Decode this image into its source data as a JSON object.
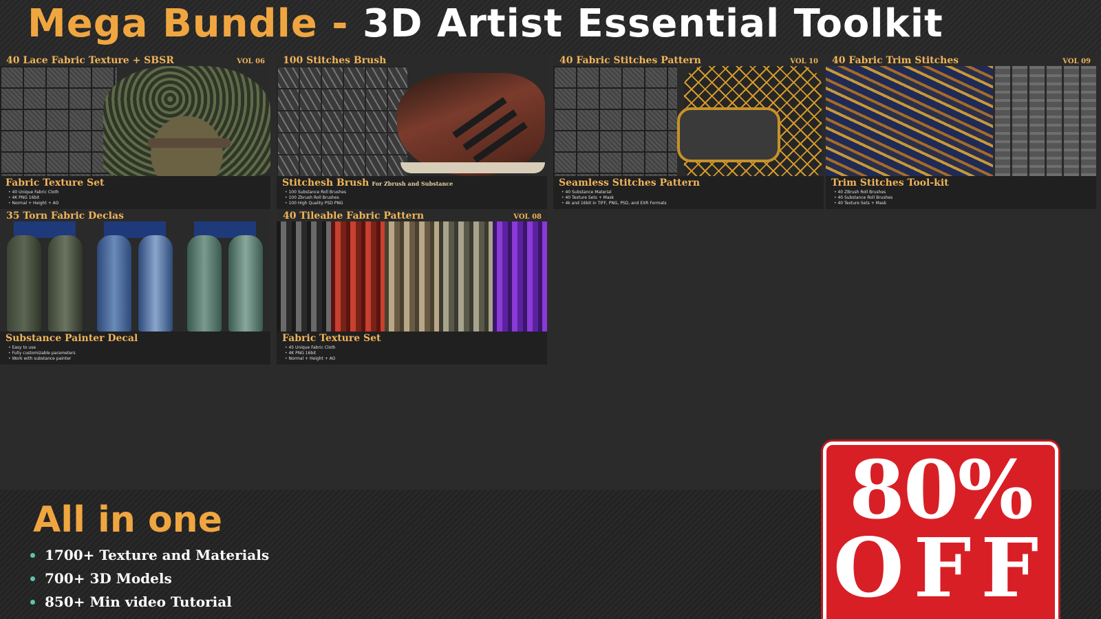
{
  "header": {
    "title_accent": "Mega Bundle",
    "title_separator": " - ",
    "title_rest": "3D Artist Essential Toolkit"
  },
  "cards": [
    {
      "title": "40 Lace Fabric Texture + SBSR",
      "vol": "VOL 06",
      "subtitle": "Fabric Texture Set",
      "subnote": "",
      "bullets": [
        "40 Unique Fabric Cloth",
        "4K PNG 16bit",
        "Normal + Height + AO"
      ]
    },
    {
      "title": "100 Stitches Brush",
      "vol": "",
      "subtitle": "Stitchesh Brush",
      "subnote": "For Zbrush and Substance",
      "bullets": [
        "100 Substance Roll Brushes",
        "100 Zbrush Roll Brushes",
        "100 High Quality PSD PNG"
      ]
    },
    {
      "title": "40 Fabric Stitches Pattern",
      "vol": "VOL 10",
      "subtitle": "Seamless Stitches Pattern",
      "subnote": "",
      "bullets": [
        "40 Substance Material",
        "40 Texture Sets + Mask",
        "4k and 16bit in TIFF, PNG, PSD, and EXR Formats"
      ]
    },
    {
      "title": "40 Fabric Trim Stitches",
      "vol": "VOL 09",
      "subtitle": "Trim Stitches Tool-kit",
      "subnote": "",
      "bullets": [
        "40 ZBrush Roll Brushes",
        "40 Substance Roll Brushes",
        "40 Texture Sets + Mask"
      ]
    },
    {
      "title": "35 Torn Fabric Declas",
      "vol": "",
      "subtitle": "Substance Painter Decal",
      "subnote": "",
      "bullets": [
        "Easy to use",
        "Fully customizable parameters",
        "Work with substance painter"
      ]
    },
    {
      "title": "40 Tileable Fabric Pattern",
      "vol": "VOL 08",
      "subtitle": "Fabric Texture Set",
      "subnote": "",
      "bullets": [
        "45 Unique Fabric Cloth",
        "4K PNG 16bit",
        "Normal + Height + AO"
      ]
    }
  ],
  "bottom": {
    "title": "All in one",
    "features": [
      "1700+ Texture and Materials",
      "700+ 3D Models",
      "850+ Min video Tutorial"
    ]
  },
  "promo": {
    "percent": "80%",
    "off": "OFF"
  },
  "colors": {
    "accent_orange": "#f0a640",
    "promo_red": "#d81f26",
    "bullet_teal": "#5cc4b0",
    "background": "#2b2b2b"
  }
}
